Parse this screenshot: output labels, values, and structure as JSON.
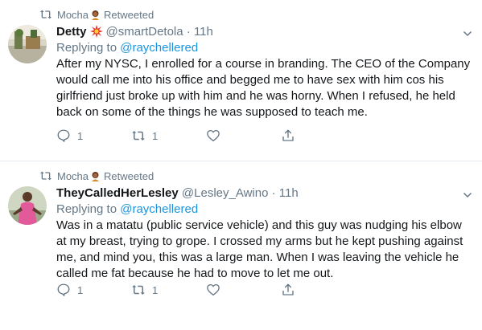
{
  "tweets": [
    {
      "retweeted_by": "Mocha",
      "retweeted_label": "Retweeted",
      "name": "Detty",
      "handle": "@smartDetola",
      "dot": "·",
      "time": "11h",
      "replying_prefix": "Replying to",
      "replying_to": "@raychellered",
      "text": "After my NYSC, I enrolled for a course in branding. The CEO of the Company would call me into his office and begged me to have sex with him cos his girlfriend just broke up with him and he was horny. When I refused, he held back on some of the things he was supposed to teach me.",
      "reply_count": "1",
      "retweet_count": "1"
    },
    {
      "retweeted_by": "Mocha",
      "retweeted_label": "Retweeted",
      "name": "TheyCalledHerLesley",
      "handle": "@Lesley_Awino",
      "dot": "·",
      "time": "11h",
      "replying_prefix": "Replying to",
      "replying_to": "@raychellered",
      "text": "Was in a matatu (public service vehicle) and this guy was nudging his elbow at my breast, trying to grope. I crossed my arms but he kept pushing against me, and mind you, this was a large man. When I was leaving the vehicle he called me fat because he had to move to let me out.",
      "reply_count": "1",
      "retweet_count": "1"
    }
  ],
  "colors": {
    "link": "#1b95e0",
    "secondary_text": "#657786",
    "divider": "#e6ecf0"
  },
  "icons": [
    "retweet-icon",
    "reply-icon",
    "like-icon",
    "share-icon",
    "caret-down-icon",
    "fire-emoji-icon",
    "woman-emoji-icon"
  ]
}
